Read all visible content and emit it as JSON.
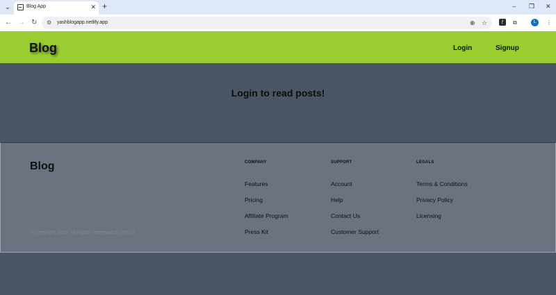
{
  "browser": {
    "tab_title": "Blog App",
    "url": "yashblogapp.netlify.app",
    "profile_initial": "L"
  },
  "navbar": {
    "brand": "Blog",
    "links": [
      "Login",
      "Signup"
    ]
  },
  "hero": {
    "message": "Login to read posts!"
  },
  "footer": {
    "brand": "Blog",
    "copyright": "© Copyright 2023. All Rights Reserved by DevUI.",
    "columns": [
      {
        "heading": "COMPANY",
        "items": [
          "Features",
          "Pricing",
          "Affiliate Program",
          "Press Kit"
        ]
      },
      {
        "heading": "SUPPORT",
        "items": [
          "Account",
          "Help",
          "Contact Us",
          "Customer Support"
        ]
      },
      {
        "heading": "LEGALS",
        "items": [
          "Terms & Conditions",
          "Privacy Policy",
          "Licensing"
        ]
      }
    ]
  },
  "colors": {
    "navbar_bg": "#9acd32",
    "page_bg": "#4a5566",
    "footer_bg": "#6b7280"
  }
}
